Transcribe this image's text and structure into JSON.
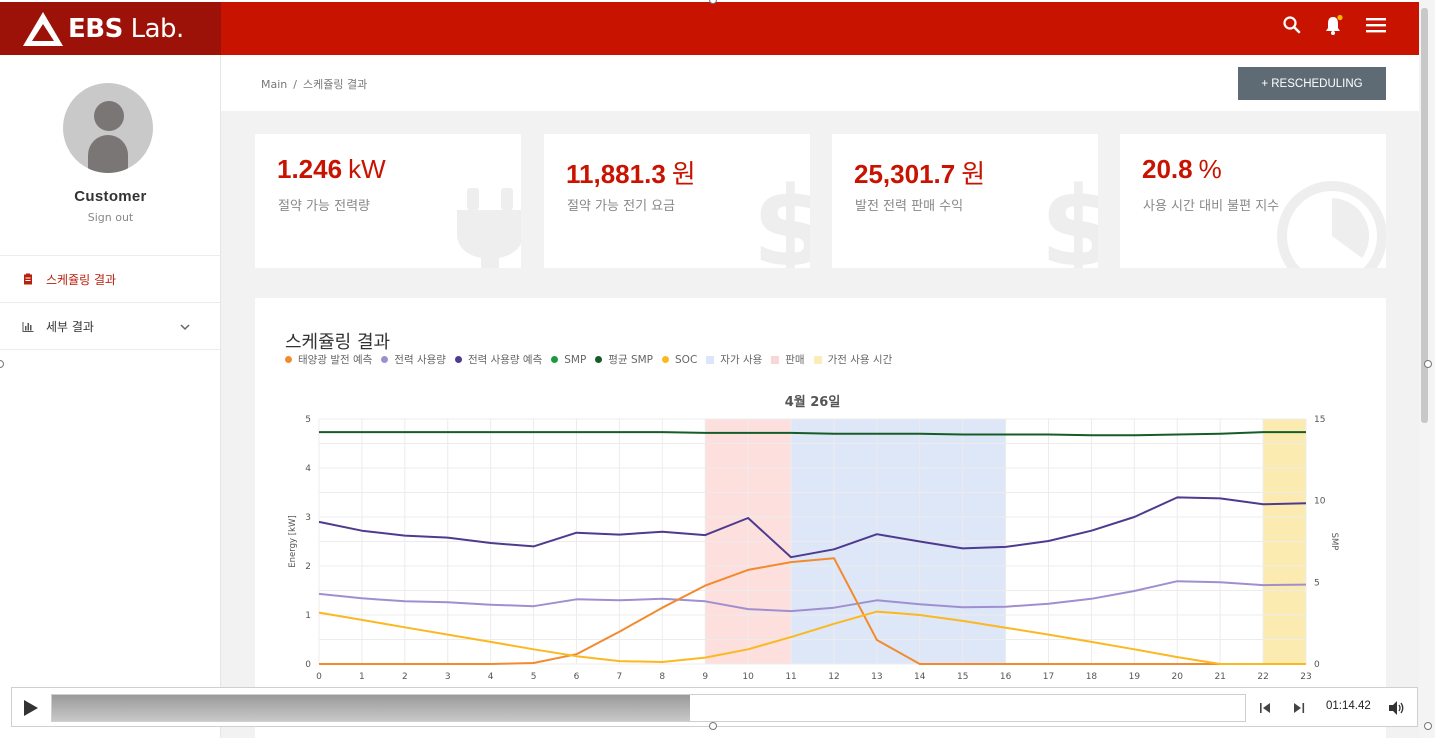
{
  "brand": {
    "logo_bold": "EBS",
    "logo_light": "Lab."
  },
  "header": {
    "icons": [
      "search-icon",
      "bell-icon",
      "menu-icon"
    ],
    "notification_dot_color": "#f5b800"
  },
  "user": {
    "name": "Customer",
    "sign_out": "Sign out"
  },
  "sidebar": {
    "items": [
      {
        "label": "스케쥴링 결과",
        "icon": "clipboard-icon",
        "active": true
      },
      {
        "label": "세부 결과",
        "icon": "bar-chart-icon",
        "expandable": true
      }
    ]
  },
  "breadcrumb": {
    "root": "Main",
    "separator": "/",
    "current": "스케쥴링 결과"
  },
  "actions": {
    "reschedule_label": "+ RESCHEDULING"
  },
  "cards": [
    {
      "value": "1.246",
      "unit": "kW",
      "label": "절약 가능 전력량",
      "icon": "plug-icon"
    },
    {
      "value": "11,881.3",
      "unit": "원",
      "label": "절약 가능 전기 요금",
      "icon": "dollar-icon"
    },
    {
      "value": "25,301.7",
      "unit": "원",
      "label": "발전 전력 판매 수익",
      "icon": "dollar-icon"
    },
    {
      "value": "20.8",
      "unit": "%",
      "label": "사용 시간 대비 불편 지수",
      "icon": "gauge-icon"
    }
  ],
  "panel": {
    "title": "스케쥴링 결과"
  },
  "colors": {
    "brand_red": "#c81300",
    "brand_dark": "#9c1208"
  },
  "chart_data": {
    "type": "line",
    "title": "4월 26일",
    "ylabel": "Energy [kW]",
    "y2label": "SMP",
    "ylim": [
      0,
      5
    ],
    "y2lim": [
      0,
      15
    ],
    "yticks": [
      0,
      1,
      2,
      3,
      4,
      5
    ],
    "y2ticks": [
      0,
      5,
      10,
      15
    ],
    "x": [
      0,
      1,
      2,
      3,
      4,
      5,
      6,
      7,
      8,
      9,
      10,
      11,
      12,
      13,
      14,
      15,
      16,
      17,
      18,
      19,
      20,
      21,
      22,
      23
    ],
    "legend": [
      {
        "name": "태양광 발전 예측",
        "color": "#f28a2e",
        "marker": "dot"
      },
      {
        "name": "전력 사용량",
        "color": "#a08fd0",
        "marker": "dot"
      },
      {
        "name": "전력 사용량 예측",
        "color": "#4e3a8f",
        "marker": "dot"
      },
      {
        "name": "SMP",
        "color": "#1e9a3e",
        "marker": "dot"
      },
      {
        "name": "평균 SMP",
        "color": "#165c26",
        "marker": "dot"
      },
      {
        "name": "SOC",
        "color": "#fbb820",
        "marker": "dot"
      },
      {
        "name": "자가 사용",
        "color": "#dbe6f8",
        "marker": "square"
      },
      {
        "name": "판매",
        "color": "#fad7d7",
        "marker": "square"
      },
      {
        "name": "가전 사용 시간",
        "color": "#fbecb8",
        "marker": "square"
      }
    ],
    "bands": [
      {
        "name": "판매",
        "from": 9,
        "to": 11,
        "color": "#fde0de"
      },
      {
        "name": "자가 사용",
        "from": 11,
        "to": 16,
        "color": "#dde7f8"
      },
      {
        "name": "가전 사용 시간",
        "from": 22,
        "to": 23,
        "color": "#fcebb0"
      }
    ],
    "series": [
      {
        "name": "평균 SMP",
        "axis": "y2",
        "color": "#165c26",
        "values": [
          14.2,
          14.2,
          14.2,
          14.2,
          14.2,
          14.2,
          14.2,
          14.2,
          14.2,
          14.15,
          14.15,
          14.15,
          14.1,
          14.1,
          14.1,
          14.05,
          14.05,
          14.05,
          14.0,
          14.0,
          14.05,
          14.1,
          14.2,
          14.2
        ]
      },
      {
        "name": "전력 사용량 예측",
        "axis": "y",
        "color": "#4e3a8f",
        "values": [
          2.9,
          2.72,
          2.62,
          2.58,
          2.47,
          2.4,
          2.68,
          2.64,
          2.7,
          2.63,
          2.98,
          2.18,
          2.34,
          2.65,
          2.5,
          2.36,
          2.39,
          2.51,
          2.72,
          3.0,
          3.4,
          3.38,
          3.26,
          3.28
        ]
      },
      {
        "name": "전력 사용량",
        "axis": "y",
        "color": "#a08fd0",
        "values": [
          1.43,
          1.34,
          1.28,
          1.26,
          1.21,
          1.18,
          1.32,
          1.3,
          1.33,
          1.28,
          1.12,
          1.08,
          1.15,
          1.3,
          1.22,
          1.16,
          1.17,
          1.23,
          1.33,
          1.49,
          1.69,
          1.67,
          1.61,
          1.62
        ]
      },
      {
        "name": "태양광 발전 예측",
        "axis": "y",
        "color": "#f28a2e",
        "values": [
          0,
          0,
          0,
          0,
          0,
          0.02,
          0.2,
          0.66,
          1.15,
          1.6,
          1.92,
          2.08,
          2.16,
          0.49,
          0,
          0,
          0,
          0,
          0,
          0,
          0,
          0,
          0,
          0
        ]
      },
      {
        "name": "SOC",
        "axis": "y",
        "color": "#fbb820",
        "values": [
          1.05,
          0.9,
          0.75,
          0.6,
          0.45,
          0.3,
          0.16,
          0.06,
          0.04,
          0.13,
          0.3,
          0.55,
          0.82,
          1.07,
          1.0,
          0.88,
          0.74,
          0.6,
          0.45,
          0.3,
          0.14,
          0,
          0,
          0
        ]
      }
    ]
  },
  "player": {
    "time": "01:14.42",
    "progress": 0.535
  }
}
